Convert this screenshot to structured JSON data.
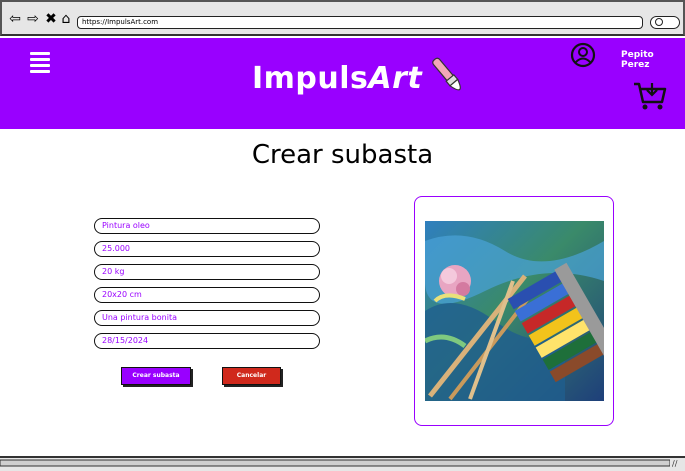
{
  "browser": {
    "url": "https://ImpulsArt.com",
    "icons": [
      "back-arrow-icon",
      "forward-arrow-icon",
      "close-x-icon",
      "home-icon"
    ]
  },
  "header": {
    "logo_main": "Impuls",
    "logo_accent": "Art",
    "user_name": "Pepito Perez",
    "background_color": "#9900ff"
  },
  "page": {
    "title": "Crear subasta"
  },
  "form": {
    "fields": [
      {
        "name": "title",
        "value": "Pintura oleo"
      },
      {
        "name": "price",
        "value": "25.000"
      },
      {
        "name": "weight",
        "value": "20 kg"
      },
      {
        "name": "dimensions",
        "value": "20x20 cm"
      },
      {
        "name": "description",
        "value": "Una pintura bonita"
      },
      {
        "name": "date",
        "value": "28/15/2024"
      }
    ],
    "create_label": "Crear subasta",
    "cancel_label": "Cancelar"
  },
  "colors": {
    "accent": "#9900ff",
    "cancel": "#d0291c"
  }
}
